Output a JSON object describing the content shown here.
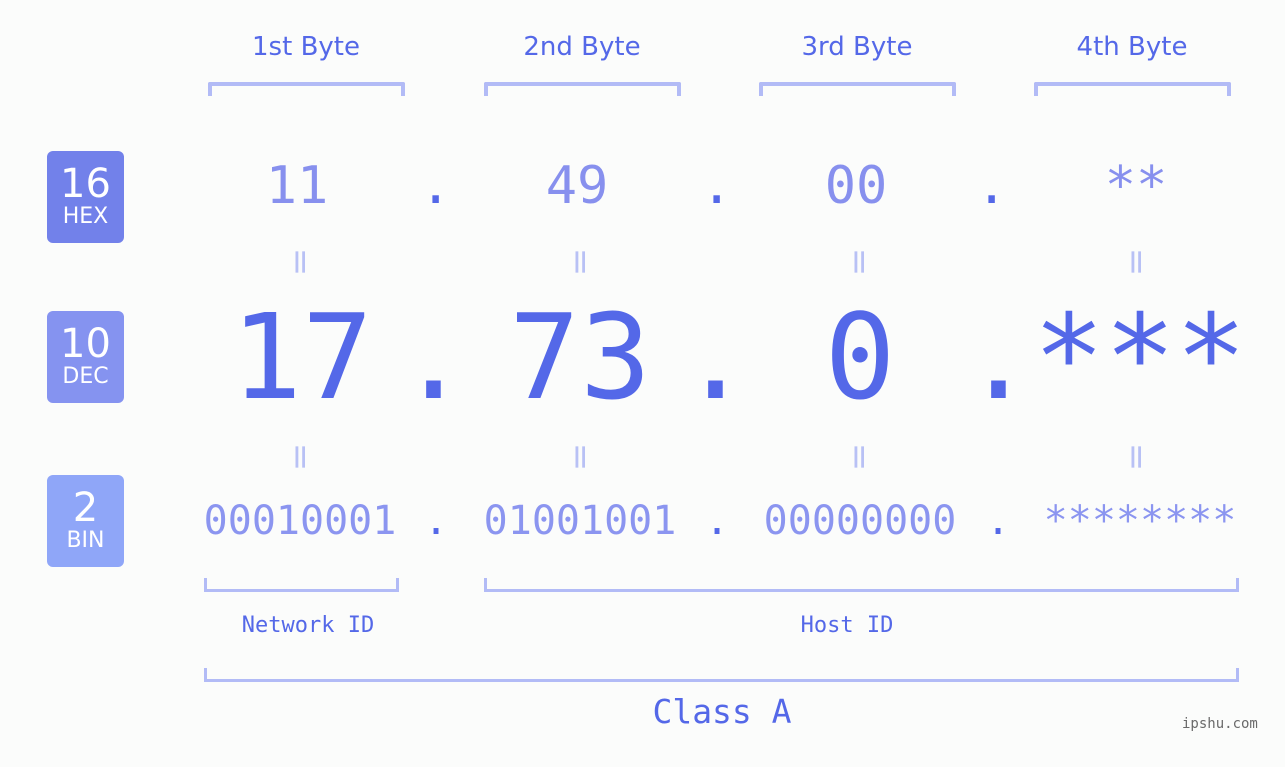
{
  "colors": {
    "accent": "#5468e8",
    "hex_value": "#8790ee",
    "bin_value": "#8b95f0",
    "bracket": "#b2bbf6",
    "badge_hex": "#7281ea",
    "badge_dec": "#8593f0",
    "badge_bin": "#8fa6f8",
    "background": "#fbfcfb"
  },
  "byte_headers": [
    "1st Byte",
    "2nd Byte",
    "3rd Byte",
    "4th Byte"
  ],
  "badges": [
    {
      "base": "16",
      "label": "HEX"
    },
    {
      "base": "10",
      "label": "DEC"
    },
    {
      "base": "2",
      "label": "BIN"
    }
  ],
  "hex": {
    "octets": [
      "11",
      "49",
      "00",
      "**"
    ]
  },
  "dec": {
    "octets": [
      "17",
      "73",
      "0",
      "***"
    ]
  },
  "bin": {
    "octets": [
      "00010001",
      "01001001",
      "00000000",
      "********"
    ]
  },
  "separator": ".",
  "equals": "=",
  "network_id_label": "Network ID",
  "host_id_label": "Host ID",
  "class_label": "Class A",
  "watermark": "ipshu.com"
}
